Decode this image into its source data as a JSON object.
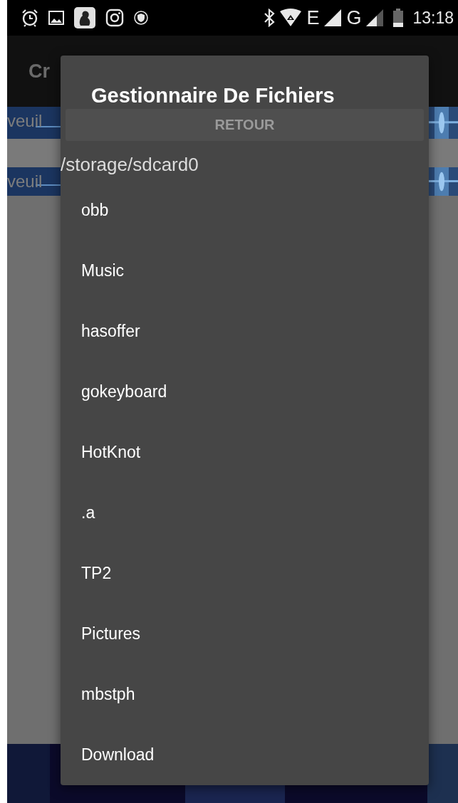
{
  "status_bar": {
    "network_labels": [
      "E",
      "G"
    ],
    "time": "13:18"
  },
  "app_bar": {
    "title": "Cr"
  },
  "background_rows": [
    {
      "text": "veuil"
    },
    {
      "text": "veuil"
    }
  ],
  "dialog": {
    "title": "Gestionnaire De Fichiers",
    "back_button": "RETOUR",
    "path": "/storage/sdcard0",
    "items": [
      {
        "name": "obb"
      },
      {
        "name": "Music"
      },
      {
        "name": "hasoffer"
      },
      {
        "name": "gokeyboard"
      },
      {
        "name": "HotKnot"
      },
      {
        "name": ".a"
      },
      {
        "name": "TP2"
      },
      {
        "name": "Pictures"
      },
      {
        "name": "mbstph"
      },
      {
        "name": "Download"
      }
    ]
  }
}
